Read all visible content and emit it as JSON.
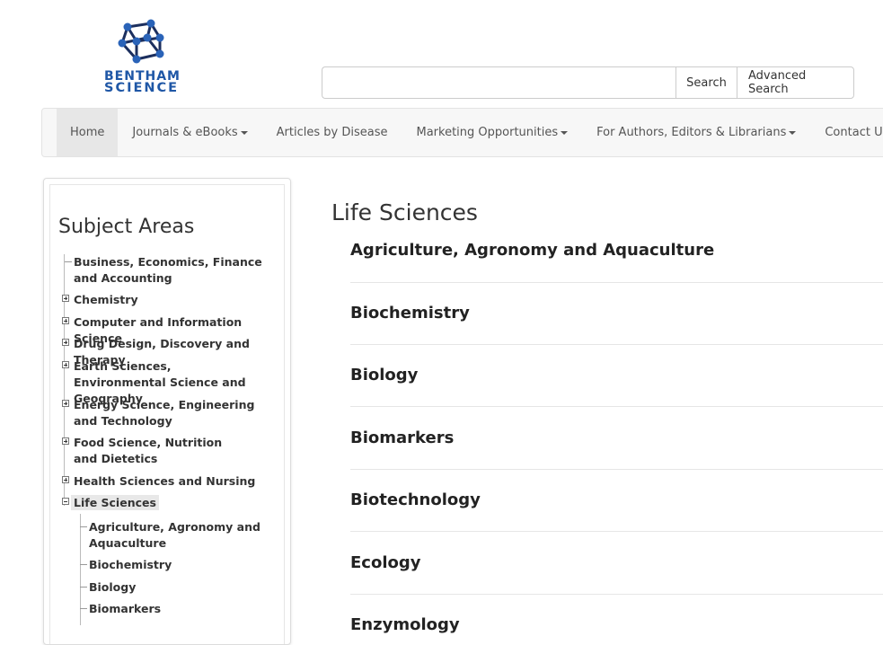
{
  "logo": {
    "line1": "BENTHAM",
    "line2": "SCIENCE"
  },
  "search": {
    "placeholder": "",
    "search_label": "Search",
    "advanced_label": "Advanced Search"
  },
  "nav": {
    "items": [
      {
        "label": "Home",
        "active": true,
        "dropdown": false
      },
      {
        "label": "Journals & eBooks",
        "active": false,
        "dropdown": true
      },
      {
        "label": "Articles by Disease",
        "active": false,
        "dropdown": false
      },
      {
        "label": "Marketing Opportunities",
        "active": false,
        "dropdown": true
      },
      {
        "label": "For Authors, Editors & Librarians",
        "active": false,
        "dropdown": true
      },
      {
        "label": "Contact Us",
        "active": false,
        "dropdown": false
      }
    ]
  },
  "sidebar": {
    "title": "Subject Areas",
    "items": [
      {
        "label": "Business, Economics, Finance and Accounting",
        "toggle": "none"
      },
      {
        "label": "Chemistry",
        "toggle": "plus"
      },
      {
        "label": "Computer and Information Science",
        "toggle": "plus"
      },
      {
        "label": "Drug Design, Discovery and Therapy",
        "toggle": "plus"
      },
      {
        "label": "Earth Sciences, Environmental Science and Geography",
        "toggle": "plus"
      },
      {
        "label": "Energy Science, Engineering and Technology",
        "toggle": "plus"
      },
      {
        "label": "Food Science, Nutrition and Dietetics",
        "toggle": "plus"
      },
      {
        "label": "Health Sciences and Nursing",
        "toggle": "plus"
      },
      {
        "label": "Life Sciences",
        "toggle": "minus",
        "selected": true
      }
    ],
    "subitems": [
      {
        "label": "Agriculture, Agronomy and Aquaculture"
      },
      {
        "label": "Biochemistry"
      },
      {
        "label": "Biology"
      },
      {
        "label": "Biomarkers"
      }
    ]
  },
  "main": {
    "title": "Life Sciences",
    "categories": [
      "Agriculture, Agronomy and Aquaculture",
      "Biochemistry",
      "Biology",
      "Biomarkers",
      "Biotechnology",
      "Ecology",
      "Enzymology"
    ]
  },
  "colors": {
    "brand": "#1f57a6",
    "navbar_bg": "#f7f7f7",
    "nav_active_bg": "#e7e7e7"
  }
}
